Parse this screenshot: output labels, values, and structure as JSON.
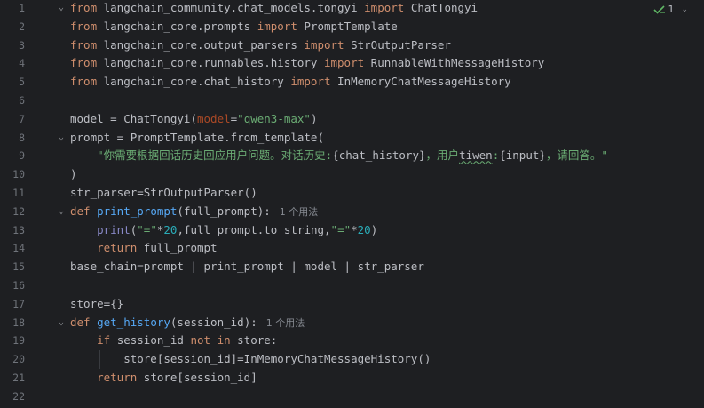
{
  "inspection": {
    "count": "1"
  },
  "lines": [
    {
      "n": "1",
      "fold": "open",
      "tokens": [
        {
          "t": "from",
          "c": "kw"
        },
        {
          "t": " langchain_community.chat_models.tongyi "
        },
        {
          "t": "import",
          "c": "kw"
        },
        {
          "t": " ChatTongyi"
        }
      ]
    },
    {
      "n": "2",
      "tokens": [
        {
          "t": "from",
          "c": "kw"
        },
        {
          "t": " langchain_core.prompts "
        },
        {
          "t": "import",
          "c": "kw"
        },
        {
          "t": " PromptTemplate"
        }
      ]
    },
    {
      "n": "3",
      "tokens": [
        {
          "t": "from",
          "c": "kw"
        },
        {
          "t": " langchain_core.output_parsers "
        },
        {
          "t": "import",
          "c": "kw"
        },
        {
          "t": " StrOutputParser"
        }
      ]
    },
    {
      "n": "4",
      "tokens": [
        {
          "t": "from",
          "c": "kw"
        },
        {
          "t": " langchain_core.runnables.history "
        },
        {
          "t": "import",
          "c": "kw"
        },
        {
          "t": " RunnableWithMessageHistory"
        }
      ]
    },
    {
      "n": "5",
      "fold": "close",
      "tokens": [
        {
          "t": "from",
          "c": "kw"
        },
        {
          "t": " langchain_core.chat_history "
        },
        {
          "t": "import",
          "c": "kw"
        },
        {
          "t": " InMemoryChatMessageHistory"
        }
      ]
    },
    {
      "n": "6",
      "tokens": []
    },
    {
      "n": "7",
      "tokens": [
        {
          "t": "model = ChatTongyi("
        },
        {
          "t": "model",
          "c": "param"
        },
        {
          "t": "="
        },
        {
          "t": "\"qwen3-max\"",
          "c": "str"
        },
        {
          "t": ")"
        }
      ]
    },
    {
      "n": "8",
      "fold": "open",
      "tokens": [
        {
          "t": "prompt = PromptTemplate.from_template("
        }
      ]
    },
    {
      "n": "9",
      "tokens": [
        {
          "t": "    "
        },
        {
          "t": "\"你需要根据回话历史回应用户问题。对话历史:",
          "c": "str"
        },
        {
          "t": "{chat_history}"
        },
        {
          "t": "，用户",
          "c": "str"
        },
        {
          "t": "tiwen",
          "c": "typo"
        },
        {
          "t": ":",
          "c": "str"
        },
        {
          "t": "{input}"
        },
        {
          "t": "，请回答。\"",
          "c": "str"
        }
      ]
    },
    {
      "n": "10",
      "fold": "close",
      "tokens": [
        {
          "t": ")"
        }
      ]
    },
    {
      "n": "11",
      "tokens": [
        {
          "t": "str_parser=StrOutputParser()"
        }
      ]
    },
    {
      "n": "12",
      "fold": "open",
      "tokens": [
        {
          "t": "def",
          "c": "kw"
        },
        {
          "t": " "
        },
        {
          "t": "print_prompt",
          "c": "fn"
        },
        {
          "t": "(full_prompt):"
        },
        {
          "t": "1 个用法",
          "c": "hint"
        }
      ]
    },
    {
      "n": "13",
      "tokens": [
        {
          "t": "    "
        },
        {
          "t": "print",
          "c": "builtin"
        },
        {
          "t": "("
        },
        {
          "t": "\"=\"",
          "c": "str"
        },
        {
          "t": "*"
        },
        {
          "t": "20",
          "c": "num"
        },
        {
          "t": ",full_prompt.to_string,"
        },
        {
          "t": "\"=\"",
          "c": "str"
        },
        {
          "t": "*"
        },
        {
          "t": "20",
          "c": "num"
        },
        {
          "t": ")"
        }
      ]
    },
    {
      "n": "14",
      "fold": "close",
      "tokens": [
        {
          "t": "    "
        },
        {
          "t": "return",
          "c": "kw"
        },
        {
          "t": " full_prompt"
        }
      ]
    },
    {
      "n": "15",
      "tokens": [
        {
          "t": "base_chain=prompt | print_prompt | model | str_parser"
        }
      ]
    },
    {
      "n": "16",
      "tokens": []
    },
    {
      "n": "17",
      "tokens": [
        {
          "t": "store={}"
        }
      ]
    },
    {
      "n": "18",
      "fold": "open",
      "tokens": [
        {
          "t": "def",
          "c": "kw"
        },
        {
          "t": " "
        },
        {
          "t": "get_history",
          "c": "fn"
        },
        {
          "t": "(session_id):"
        },
        {
          "t": "1 个用法",
          "c": "hint"
        }
      ]
    },
    {
      "n": "19",
      "tokens": [
        {
          "t": "    "
        },
        {
          "t": "if",
          "c": "kw"
        },
        {
          "t": " session_id "
        },
        {
          "t": "not in",
          "c": "kw"
        },
        {
          "t": " store:"
        }
      ]
    },
    {
      "n": "20",
      "tokens": [
        {
          "t": "        store[session_id]=InMemoryChatMessageHistory()"
        }
      ]
    },
    {
      "n": "21",
      "fold": "close",
      "tokens": [
        {
          "t": "    "
        },
        {
          "t": "return",
          "c": "kw"
        },
        {
          "t": " store[session_id]"
        }
      ]
    },
    {
      "n": "22",
      "tokens": []
    }
  ]
}
